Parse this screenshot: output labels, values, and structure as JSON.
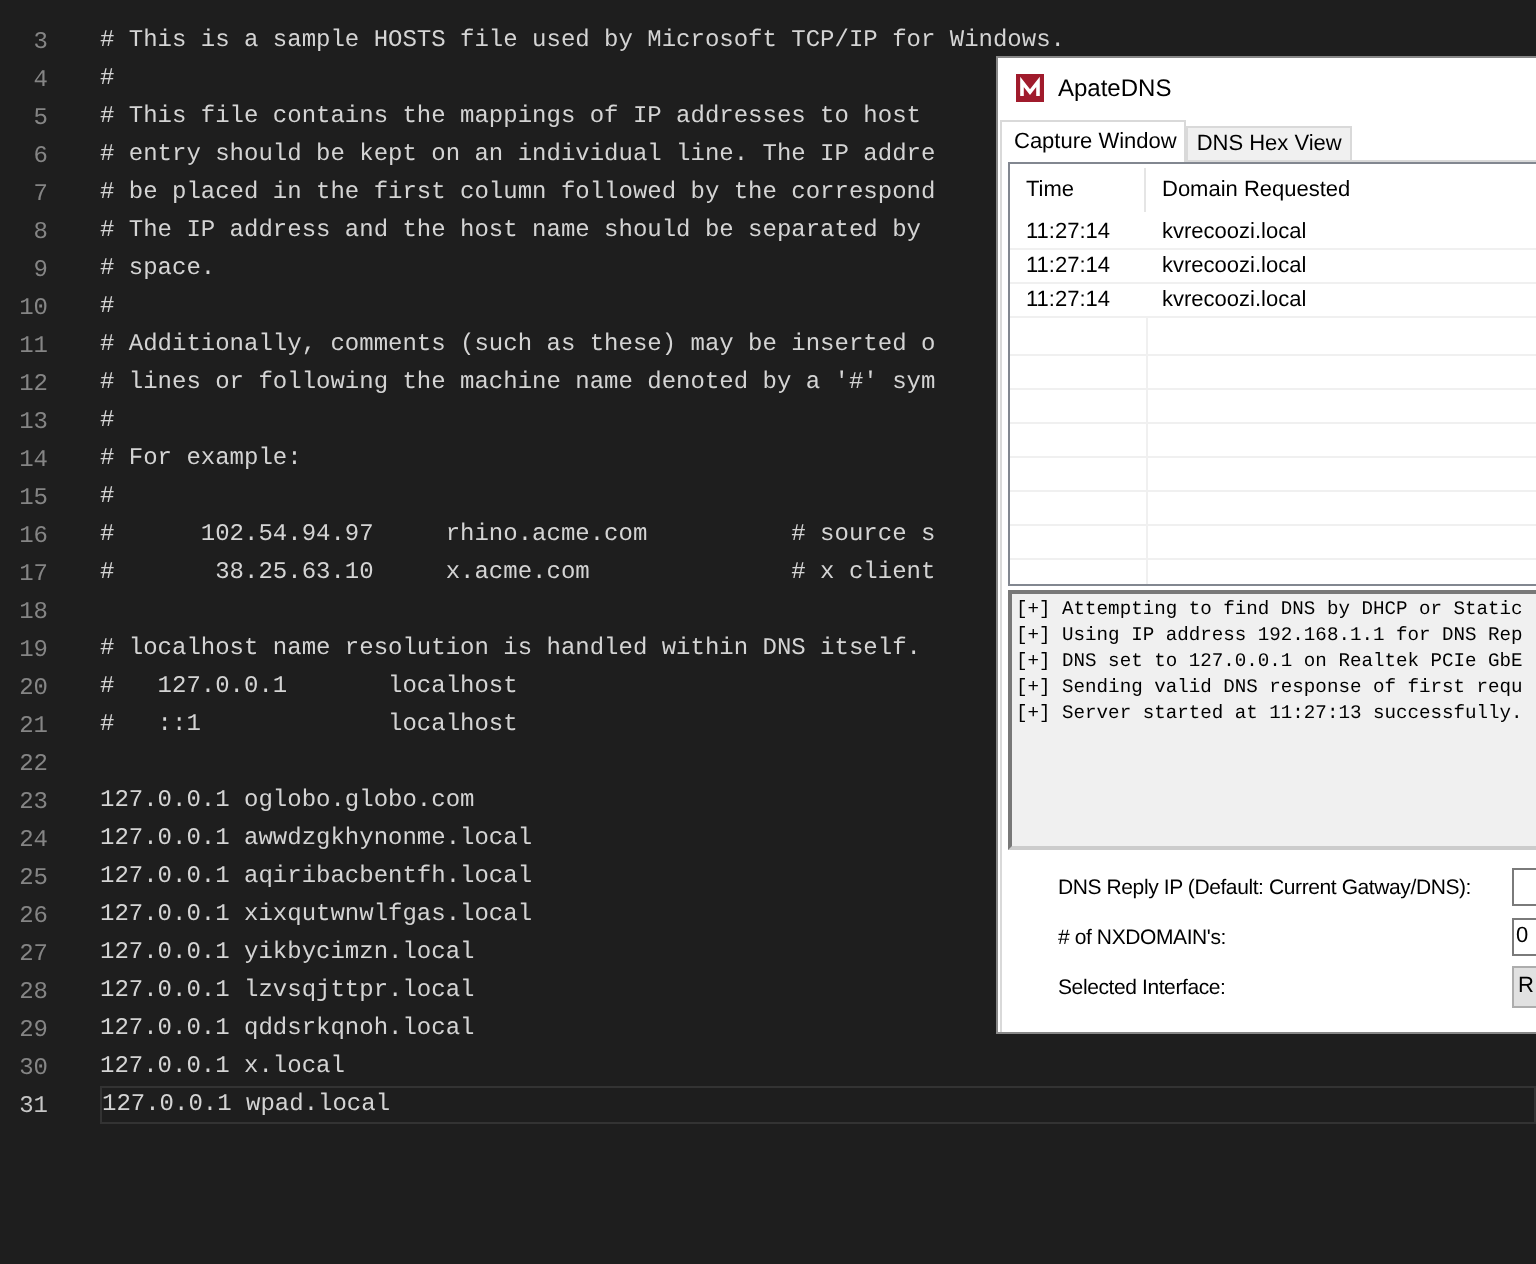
{
  "editor": {
    "lines": [
      {
        "number": "3",
        "text": "# This is a sample HOSTS file used by Microsoft TCP/IP for Windows.",
        "current": false
      },
      {
        "number": "4",
        "text": "#",
        "current": false
      },
      {
        "number": "5",
        "text": "# This file contains the mappings of IP addresses to host",
        "current": false
      },
      {
        "number": "6",
        "text": "# entry should be kept on an individual line. The IP addre",
        "current": false
      },
      {
        "number": "7",
        "text": "# be placed in the first column followed by the correspond",
        "current": false
      },
      {
        "number": "8",
        "text": "# The IP address and the host name should be separated by",
        "current": false
      },
      {
        "number": "9",
        "text": "# space.",
        "current": false
      },
      {
        "number": "10",
        "text": "#",
        "current": false
      },
      {
        "number": "11",
        "text": "# Additionally, comments (such as these) may be inserted o",
        "current": false
      },
      {
        "number": "12",
        "text": "# lines or following the machine name denoted by a '#' sym",
        "current": false
      },
      {
        "number": "13",
        "text": "#",
        "current": false
      },
      {
        "number": "14",
        "text": "# For example:",
        "current": false
      },
      {
        "number": "15",
        "text": "#",
        "current": false
      },
      {
        "number": "16",
        "text": "#      102.54.94.97     rhino.acme.com          # source s",
        "current": false
      },
      {
        "number": "17",
        "text": "#       38.25.63.10     x.acme.com              # x client",
        "current": false
      },
      {
        "number": "18",
        "current": false
      },
      {
        "number": "19",
        "text": "# localhost name resolution is handled within DNS itself.",
        "current": false
      },
      {
        "number": "20",
        "text": "#   127.0.0.1       localhost",
        "current": false
      },
      {
        "number": "21",
        "text": "#   ::1             localhost",
        "current": false
      },
      {
        "number": "22",
        "current": false
      },
      {
        "number": "23",
        "text": "127.0.0.1 oglobo.globo.com",
        "current": false
      },
      {
        "number": "24",
        "text": "127.0.0.1 awwdzgkhynonme.local",
        "current": false
      },
      {
        "number": "25",
        "text": "127.0.0.1 aqiribacbentfh.local",
        "current": false
      },
      {
        "number": "26",
        "text": "127.0.0.1 xixqutwnwlfgas.local",
        "current": false
      },
      {
        "number": "27",
        "text": "127.0.0.1 yikbycimzn.local",
        "current": false
      },
      {
        "number": "28",
        "text": "127.0.0.1 lzvsqjttpr.local",
        "current": false
      },
      {
        "number": "29",
        "text": "127.0.0.1 qddsrkqnoh.local",
        "current": false
      },
      {
        "number": "30",
        "text": "127.0.0.1 x.local",
        "current": false
      },
      {
        "number": "31",
        "text": "127.0.0.1 wpad.local",
        "current": true
      }
    ]
  },
  "apate": {
    "title": "ApateDNS",
    "tabs": [
      {
        "label": "Capture Window",
        "selected": true
      },
      {
        "label": "DNS Hex View",
        "selected": false
      }
    ],
    "columns": [
      "Time",
      "Domain Requested"
    ],
    "rows": [
      {
        "time": "11:27:14",
        "domain": "kvrecoozi.local"
      },
      {
        "time": "11:27:14",
        "domain": "kvrecoozi.local"
      },
      {
        "time": "11:27:14",
        "domain": "kvrecoozi.local"
      }
    ],
    "log": [
      "[+] Attempting to find DNS by DHCP or Static",
      "[+] Using IP address 192.168.1.1 for DNS Rep",
      "[+] DNS set to 127.0.0.1 on Realtek PCIe GbE",
      "[+] Sending valid DNS response of first requ",
      "[+] Server started at 11:27:13 successfully."
    ],
    "settings": [
      {
        "kind": "field",
        "label": "DNS Reply IP (Default: Current Gatway/DNS):"
      },
      {
        "kind": "field",
        "label": "# of NXDOMAIN's:",
        "value": "0"
      },
      {
        "kind": "dropdown",
        "label": "Selected Interface:",
        "value": "R"
      }
    ]
  }
}
